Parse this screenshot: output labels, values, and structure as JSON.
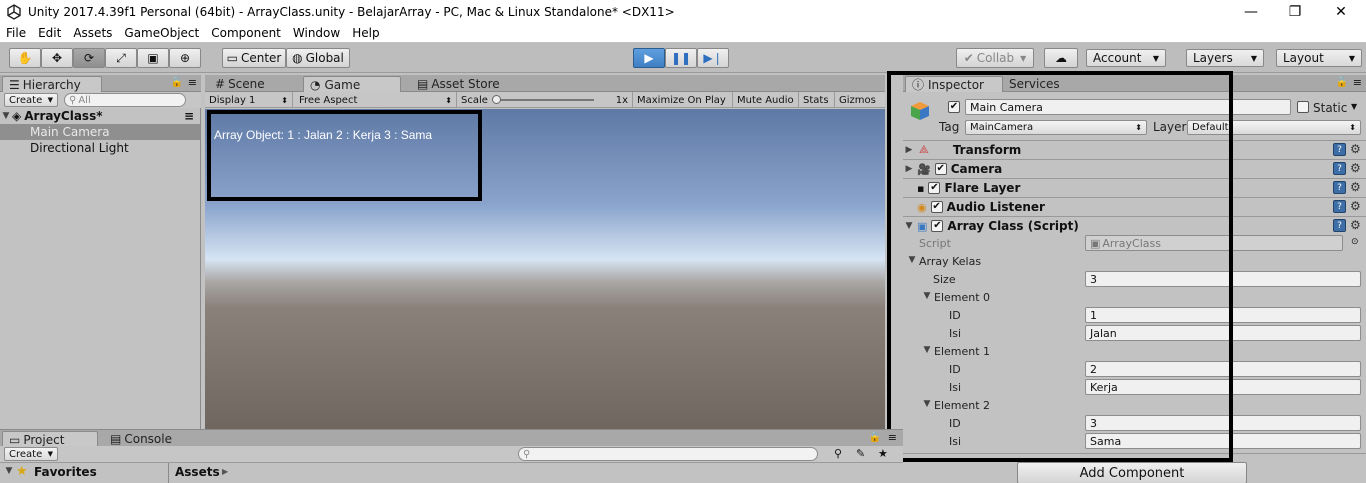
{
  "window": {
    "title": "Unity 2017.4.39f1 Personal (64bit) - ArrayClass.unity - BelajarArray - PC, Mac & Linux Standalone* <DX11>"
  },
  "menu": [
    "File",
    "Edit",
    "Assets",
    "GameObject",
    "Component",
    "Window",
    "Help"
  ],
  "toolbar": {
    "pivot_label": "Center",
    "space_label": "Global",
    "collab_label": "Collab",
    "account_label": "Account",
    "layers_label": "Layers",
    "layout_label": "Layout"
  },
  "hierarchy": {
    "tab_label": "Hierarchy",
    "create_label": "Create",
    "search_placeholder": "All",
    "scene_name": "ArrayClass*",
    "items": [
      "Main Camera",
      "Directional Light"
    ]
  },
  "center_tabs": [
    "Scene",
    "Game",
    "Asset Store"
  ],
  "game_bar": {
    "display": "Display 1",
    "aspect": "Free Aspect",
    "scale_label": "Scale",
    "scale_value": "1x",
    "maximize": "Maximize On Play",
    "mute": "Mute Audio",
    "stats": "Stats",
    "gizmos": "Gizmos"
  },
  "game_view": {
    "text": "Array Object:  1 : Jalan 2 : Kerja 3 : Sama"
  },
  "inspector": {
    "tab_label": "Inspector",
    "services_label": "Services",
    "object_name": "Main Camera",
    "static_label": "Static",
    "tag_label": "Tag",
    "tag_value": "MainCamera",
    "layer_label": "Layer",
    "layer_value": "Default",
    "components": [
      "Transform",
      "Camera",
      "Flare Layer",
      "Audio Listener",
      "Array Class (Script)"
    ],
    "script_label": "Script",
    "script_value": "ArrayClass",
    "array_label": "Array Kelas",
    "size_label": "Size",
    "size_value": "3",
    "elements": [
      {
        "label": "Element 0",
        "id_label": "ID",
        "id": "1",
        "isi_label": "Isi",
        "isi": "Jalan"
      },
      {
        "label": "Element 1",
        "id_label": "ID",
        "id": "2",
        "isi_label": "Isi",
        "isi": "Kerja"
      },
      {
        "label": "Element 2",
        "id_label": "ID",
        "id": "3",
        "isi_label": "Isi",
        "isi": "Sama"
      }
    ],
    "add_component_label": "Add Component"
  },
  "bottom": {
    "project_tab": "Project",
    "console_tab": "Console",
    "create_label": "Create",
    "favorites_label": "Favorites",
    "assets_label": "Assets"
  },
  "colors": {
    "play_blue": "#4a8ad4",
    "highlight_border": "#000000"
  }
}
